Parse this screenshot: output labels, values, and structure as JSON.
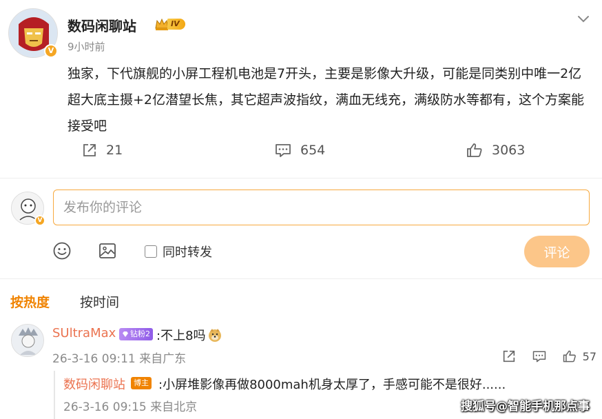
{
  "post": {
    "author": "数码闲聊站",
    "level_badge": "IV",
    "time": "9小时前",
    "text": "独家，下代旗舰的小屏工程机电池是7开头，主要是影像大升级，可能是同类别中唯一2亿超大底主摄+2亿潜望长焦，其它超声波指纹，满血无线充，满级防水等都有，这个方案能接受吧",
    "reposts": "21",
    "comments": "654",
    "likes": "3063"
  },
  "composer": {
    "placeholder": "发布你的评论",
    "repost_label": "同时转发",
    "submit_label": "评论"
  },
  "sort": {
    "hot_label": "按热度",
    "time_label": "按时间"
  },
  "comments": [
    {
      "user": "SUltraMax",
      "badge": "钻粉2",
      "text": ":不上8吗",
      "meta": "26-3-16 09:11 来自广东",
      "likes": "57"
    }
  ],
  "replies": [
    {
      "user": "数码闲聊站",
      "badge": "博主",
      "text": ":小屏堆影像再做8000mah机身太厚了，手感可能不是很好......",
      "meta": "26-3-16 09:15 来自北京"
    }
  ],
  "watermark": "搜狐号@智能手机那点事",
  "colors": {
    "accent": "#f08300",
    "username": "#eb7350",
    "input_border": "#f7a93e",
    "submit_bg": "#fcc689"
  },
  "icons": {
    "post_menu": "chevron-down-icon",
    "repost": "share-icon",
    "comment": "comment-icon",
    "like": "thumb-up-icon",
    "emoji": "smiley-icon",
    "image": "image-icon"
  }
}
